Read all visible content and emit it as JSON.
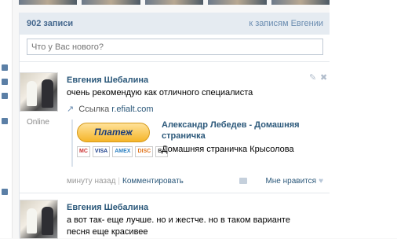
{
  "wall": {
    "count_label": "902 записи",
    "to_owner_link": "к записям Евгении",
    "composer_placeholder": "Что у Вас нового?"
  },
  "posts": [
    {
      "author": "Евгения Шебалина",
      "lines": [
        "очень рекомендую как отличного специалиста"
      ],
      "status": "Online",
      "link_prefix": "Ссылка",
      "link_url": "r.efialt.com",
      "attachment": {
        "button_label": "Платеж",
        "cards": [
          "VISA",
          "AMEX",
          "DISC",
          "BA"
        ],
        "title": "Александр Лебедев - Домашняя страничка",
        "description": "Домашняя страничка Крысолова"
      },
      "time": "минуту назад",
      "comment_label": "Комментировать",
      "like_label": "Мне нравится"
    },
    {
      "author": "Евгения Шебалина",
      "lines": [
        "а вот так- еще лучше. но и жестче. но в таком варианте",
        "песня еще красивее"
      ]
    }
  ],
  "colors": {
    "header_bg": "#e5ebf1",
    "link_blue": "#2b587a",
    "muted_blue": "#6a8cb0"
  },
  "icons": {
    "edit": "pencil-icon",
    "delete": "close-icon",
    "link": "link-arrow-icon",
    "like": "heart-icon",
    "share": "megaphone-icon"
  }
}
